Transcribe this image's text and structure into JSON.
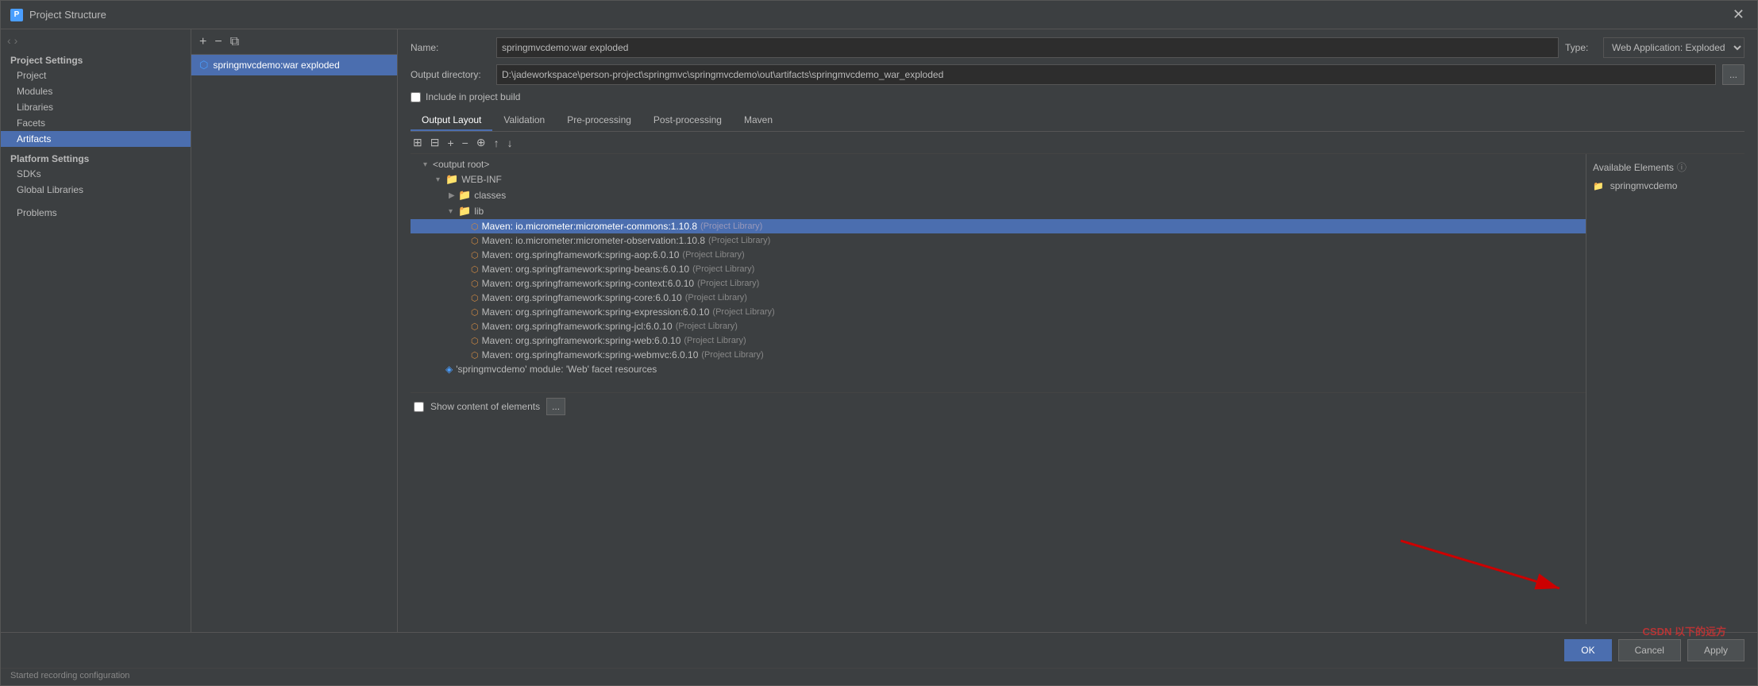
{
  "window": {
    "title": "Project Structure",
    "close_btn": "✕"
  },
  "sidebar": {
    "project_settings_label": "Project Settings",
    "items": [
      {
        "id": "project",
        "label": "Project"
      },
      {
        "id": "modules",
        "label": "Modules"
      },
      {
        "id": "libraries",
        "label": "Libraries"
      },
      {
        "id": "facets",
        "label": "Facets"
      },
      {
        "id": "artifacts",
        "label": "Artifacts",
        "active": true
      }
    ],
    "platform_settings_label": "Platform Settings",
    "platform_items": [
      {
        "id": "sdks",
        "label": "SDKs"
      },
      {
        "id": "global-libraries",
        "label": "Global Libraries"
      }
    ],
    "problems_label": "Problems"
  },
  "artifact_list": {
    "toolbar": {
      "add": "+",
      "remove": "−",
      "copy": "⧉"
    },
    "items": [
      {
        "id": "springmvcdemo-war-exploded",
        "label": "springmvcdemo:war exploded",
        "active": true
      }
    ]
  },
  "detail": {
    "name_label": "Name:",
    "name_value": "springmvcdemo:war exploded",
    "output_dir_label": "Output directory:",
    "output_dir_value": "D:\\jadeworkspace\\person-project\\springmvc\\springmvcdemo\\out\\artifacts\\springmvcdemo_war_exploded",
    "include_in_build_label": "Include in project build",
    "type_label": "Type:",
    "type_value": "Web Application: Exploded",
    "browse_btn": "...",
    "tabs": [
      {
        "id": "output-layout",
        "label": "Output Layout",
        "active": true
      },
      {
        "id": "validation",
        "label": "Validation"
      },
      {
        "id": "pre-processing",
        "label": "Pre-processing"
      },
      {
        "id": "post-processing",
        "label": "Post-processing"
      },
      {
        "id": "maven",
        "label": "Maven"
      }
    ],
    "output_layout": {
      "toolbar_btns": [
        "⊞",
        "⊟",
        "+",
        "−",
        "⊕",
        "↑",
        "↓"
      ],
      "tree": {
        "root": "<output root>",
        "web_inf": "WEB-INF",
        "classes": "classes",
        "lib": "lib",
        "maven_items": [
          {
            "label": "Maven: io.micrometer:micrometer-commons:1.10.8",
            "lib": "(Project Library)",
            "selected": true
          },
          {
            "label": "Maven: io.micrometer:micrometer-observation:1.10.8",
            "lib": "(Project Library)"
          },
          {
            "label": "Maven: org.springframework:spring-aop:6.0.10",
            "lib": "(Project Library)"
          },
          {
            "label": "Maven: org.springframework:spring-beans:6.0.10",
            "lib": "(Project Library)"
          },
          {
            "label": "Maven: org.springframework:spring-context:6.0.10",
            "lib": "(Project Library)"
          },
          {
            "label": "Maven: org.springframework:spring-core:6.0.10",
            "lib": "(Project Library)"
          },
          {
            "label": "Maven: org.springframework:spring-expression:6.0.10",
            "lib": "(Project Library)"
          },
          {
            "label": "Maven: org.springframework:spring-jcl:6.0.10",
            "lib": "(Project Library)"
          },
          {
            "label": "Maven: org.springframework:spring-web:6.0.10",
            "lib": "(Project Library)"
          },
          {
            "label": "Maven: org.springframework:spring-webmvc:6.0.10",
            "lib": "(Project Library)"
          }
        ],
        "module_item": "'springmvcdemo' module: 'Web' facet resources"
      },
      "available_elements_title": "Available Elements",
      "available_items": [
        {
          "label": "springmvcdemo",
          "icon": "folder"
        }
      ],
      "show_content_label": "Show content of elements",
      "show_content_btn": "..."
    }
  },
  "footer": {
    "ok_label": "OK",
    "cancel_label": "Cancel",
    "apply_label": "Apply"
  },
  "status": {
    "text": "Started recording configuration"
  },
  "watermark": "CSDN 以下的远方"
}
